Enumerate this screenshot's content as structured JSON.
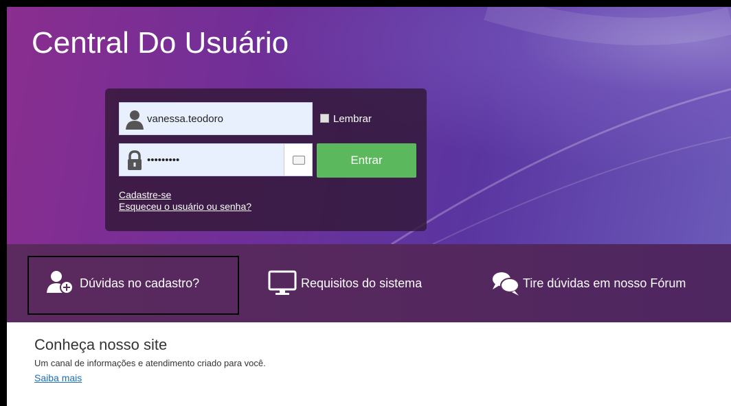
{
  "header": {
    "title": "Central Do Usuário"
  },
  "login": {
    "username_value": "vanessa.teodoro",
    "password_value": "•••••••••",
    "remember_label": "Lembrar",
    "submit_label": "Entrar",
    "register_link": "Cadastre-se",
    "forgot_link": "Esqueceu o usuário ou senha?"
  },
  "nav": {
    "items": [
      {
        "label": "Dúvidas no cadastro?",
        "icon": "user-add-icon"
      },
      {
        "label": "Requisitos do sistema",
        "icon": "monitor-icon"
      },
      {
        "label": "Tire dúvidas em nosso Fórum",
        "icon": "chat-bubbles-icon"
      }
    ]
  },
  "about": {
    "heading": "Conheça nosso site",
    "description": "Um canal de informações e atendimento criado para você.",
    "link": "Saiba mais"
  },
  "colors": {
    "accent_green": "#5cb85c",
    "hero_purple": "#6f2f98",
    "link_blue": "#1a6fb5"
  }
}
